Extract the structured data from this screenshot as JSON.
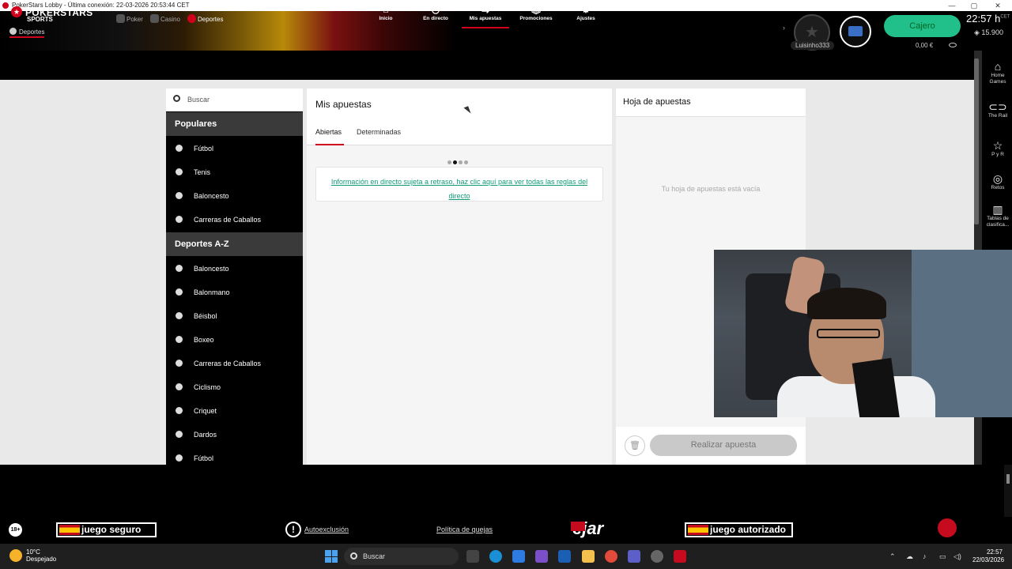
{
  "window": {
    "title": "PokerStars Lobby - Última conexión: 22-03-2026 20:53:44 CET"
  },
  "brand": {
    "line1": "POKERSTARS",
    "line2": "SPORTS",
    "section": "Deportes"
  },
  "products": [
    "Poker",
    "Casino",
    "Deportes"
  ],
  "account": {
    "username": "Luisinho333",
    "cashier": "Cajero",
    "balance": "0,00 €",
    "time": "22:57 h",
    "timezone": "CET",
    "points": "15.900"
  },
  "nav": [
    {
      "label": "Inicio",
      "icon": "home-icon"
    },
    {
      "label": "En directo",
      "icon": "stopwatch-icon"
    },
    {
      "label": "Mis apuestas",
      "icon": "swap-icon"
    },
    {
      "label": "Promociones",
      "icon": "gift-icon"
    },
    {
      "label": "Ajustes",
      "icon": "gear-icon"
    }
  ],
  "rail": [
    {
      "label": "Home Games",
      "icon": "house-icon"
    },
    {
      "label": "The Rail",
      "icon": "rail-icon"
    },
    {
      "label": "P y R",
      "icon": "star-icon"
    },
    {
      "label": "Retos",
      "icon": "target-icon"
    },
    {
      "label": "Tablas de clasifica...",
      "icon": "bars-icon"
    }
  ],
  "sidebar": {
    "search_placeholder": "Buscar",
    "popular_header": "Populares",
    "popular": [
      "Fútbol",
      "Tenis",
      "Baloncesto",
      "Carreras de Caballos"
    ],
    "az_header": "Deportes A-Z",
    "az": [
      "Baloncesto",
      "Balonmano",
      "Béisbol",
      "Boxeo",
      "Carreras de Caballos",
      "Ciclismo",
      "Criquet",
      "Dardos",
      "Fútbol"
    ]
  },
  "main": {
    "title": "Mis apuestas",
    "tabs": [
      "Abiertas",
      "Determinadas"
    ],
    "info_link": "Información en directo sujeta a retraso, haz clic aquí para ver todas las reglas del directo"
  },
  "betslip": {
    "title": "Hoja de apuestas",
    "empty": "Tu hoja de apuestas está vacía",
    "place_bet": "Realizar apuesta"
  },
  "footer": {
    "age": "18+",
    "badge_left": "juego seguro",
    "self_exclusion": "Autoexclusión",
    "complaints": "Política de quejas",
    "logo": "ejar",
    "badge_right": "juego autorizado"
  },
  "taskbar": {
    "temp": "10°C",
    "weather": "Despejado",
    "search": "Buscar",
    "time": "22:57",
    "date": "22/03/2026"
  }
}
